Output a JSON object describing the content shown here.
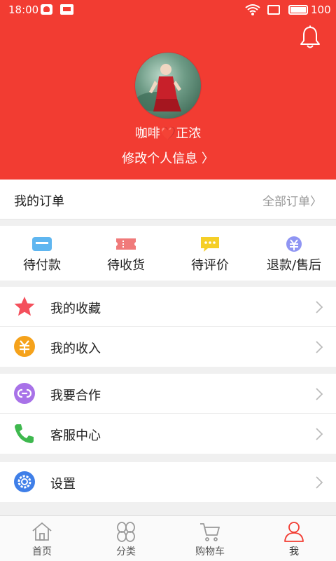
{
  "status_bar": {
    "time": "18:00",
    "battery": "100"
  },
  "profile": {
    "nickname": "咖啡❤️正浓",
    "edit_label": "修改个人信息 〉"
  },
  "orders": {
    "title": "我的订单",
    "all_label": "全部订单〉",
    "statuses": [
      {
        "label": "待付款",
        "icon": "wallet-card-icon",
        "color": "#5fb6f0"
      },
      {
        "label": "待收货",
        "icon": "ticket-icon",
        "color": "#f07a7a"
      },
      {
        "label": "待评价",
        "icon": "comment-icon",
        "color": "#f5cf28"
      },
      {
        "label": "退款/售后",
        "icon": "yuan-circle-icon",
        "color": "#8f95f3"
      }
    ]
  },
  "menu_groups": [
    [
      {
        "label": "我的收藏",
        "icon": "star-icon",
        "color": "#f4505c"
      },
      {
        "label": "我的收入",
        "icon": "yuan-coin-icon",
        "color": "#f5a21b"
      }
    ],
    [
      {
        "label": "我要合作",
        "icon": "link-icon",
        "color": "#a872e8"
      },
      {
        "label": "客服中心",
        "icon": "phone-icon",
        "color": "#3eb84e"
      }
    ],
    [
      {
        "label": "设置",
        "icon": "gear-icon",
        "color": "#3f7fe8"
      }
    ]
  ],
  "bottom_nav": [
    {
      "label": "首页",
      "icon": "home-icon"
    },
    {
      "label": "分类",
      "icon": "category-icon"
    },
    {
      "label": "购物车",
      "icon": "cart-icon"
    },
    {
      "label": "我",
      "icon": "user-icon",
      "active": true
    }
  ],
  "colors": {
    "header": "#f23c32",
    "active_nav": "#f23c32"
  }
}
